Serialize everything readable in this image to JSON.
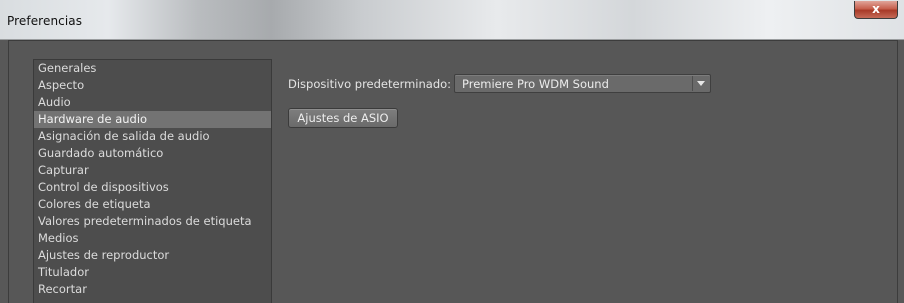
{
  "window": {
    "title": "Preferencias",
    "close_label": "x"
  },
  "sidebar": {
    "selected": "Hardware de audio",
    "items": [
      {
        "label": "Generales"
      },
      {
        "label": "Aspecto"
      },
      {
        "label": "Audio"
      },
      {
        "label": "Hardware de audio"
      },
      {
        "label": "Asignación de salida de audio"
      },
      {
        "label": "Guardado automático"
      },
      {
        "label": "Capturar"
      },
      {
        "label": "Control de dispositivos"
      },
      {
        "label": "Colores de etiqueta"
      },
      {
        "label": "Valores predeterminados de etiqueta"
      },
      {
        "label": "Medios"
      },
      {
        "label": "Ajustes de reproductor"
      },
      {
        "label": "Titulador"
      },
      {
        "label": "Recortar"
      }
    ]
  },
  "audio_hardware": {
    "default_device_label": "Dispositivo predeterminado:",
    "default_device_value": "Premiere Pro WDM Sound",
    "asio_button_label": "Ajustes de ASIO"
  },
  "icons": {
    "close": "close-icon",
    "dropdown": "chevron-down-icon"
  },
  "colors": {
    "panel_bg": "#585858",
    "selected_item_bg": "#737373",
    "close_button": "#c7604e"
  }
}
